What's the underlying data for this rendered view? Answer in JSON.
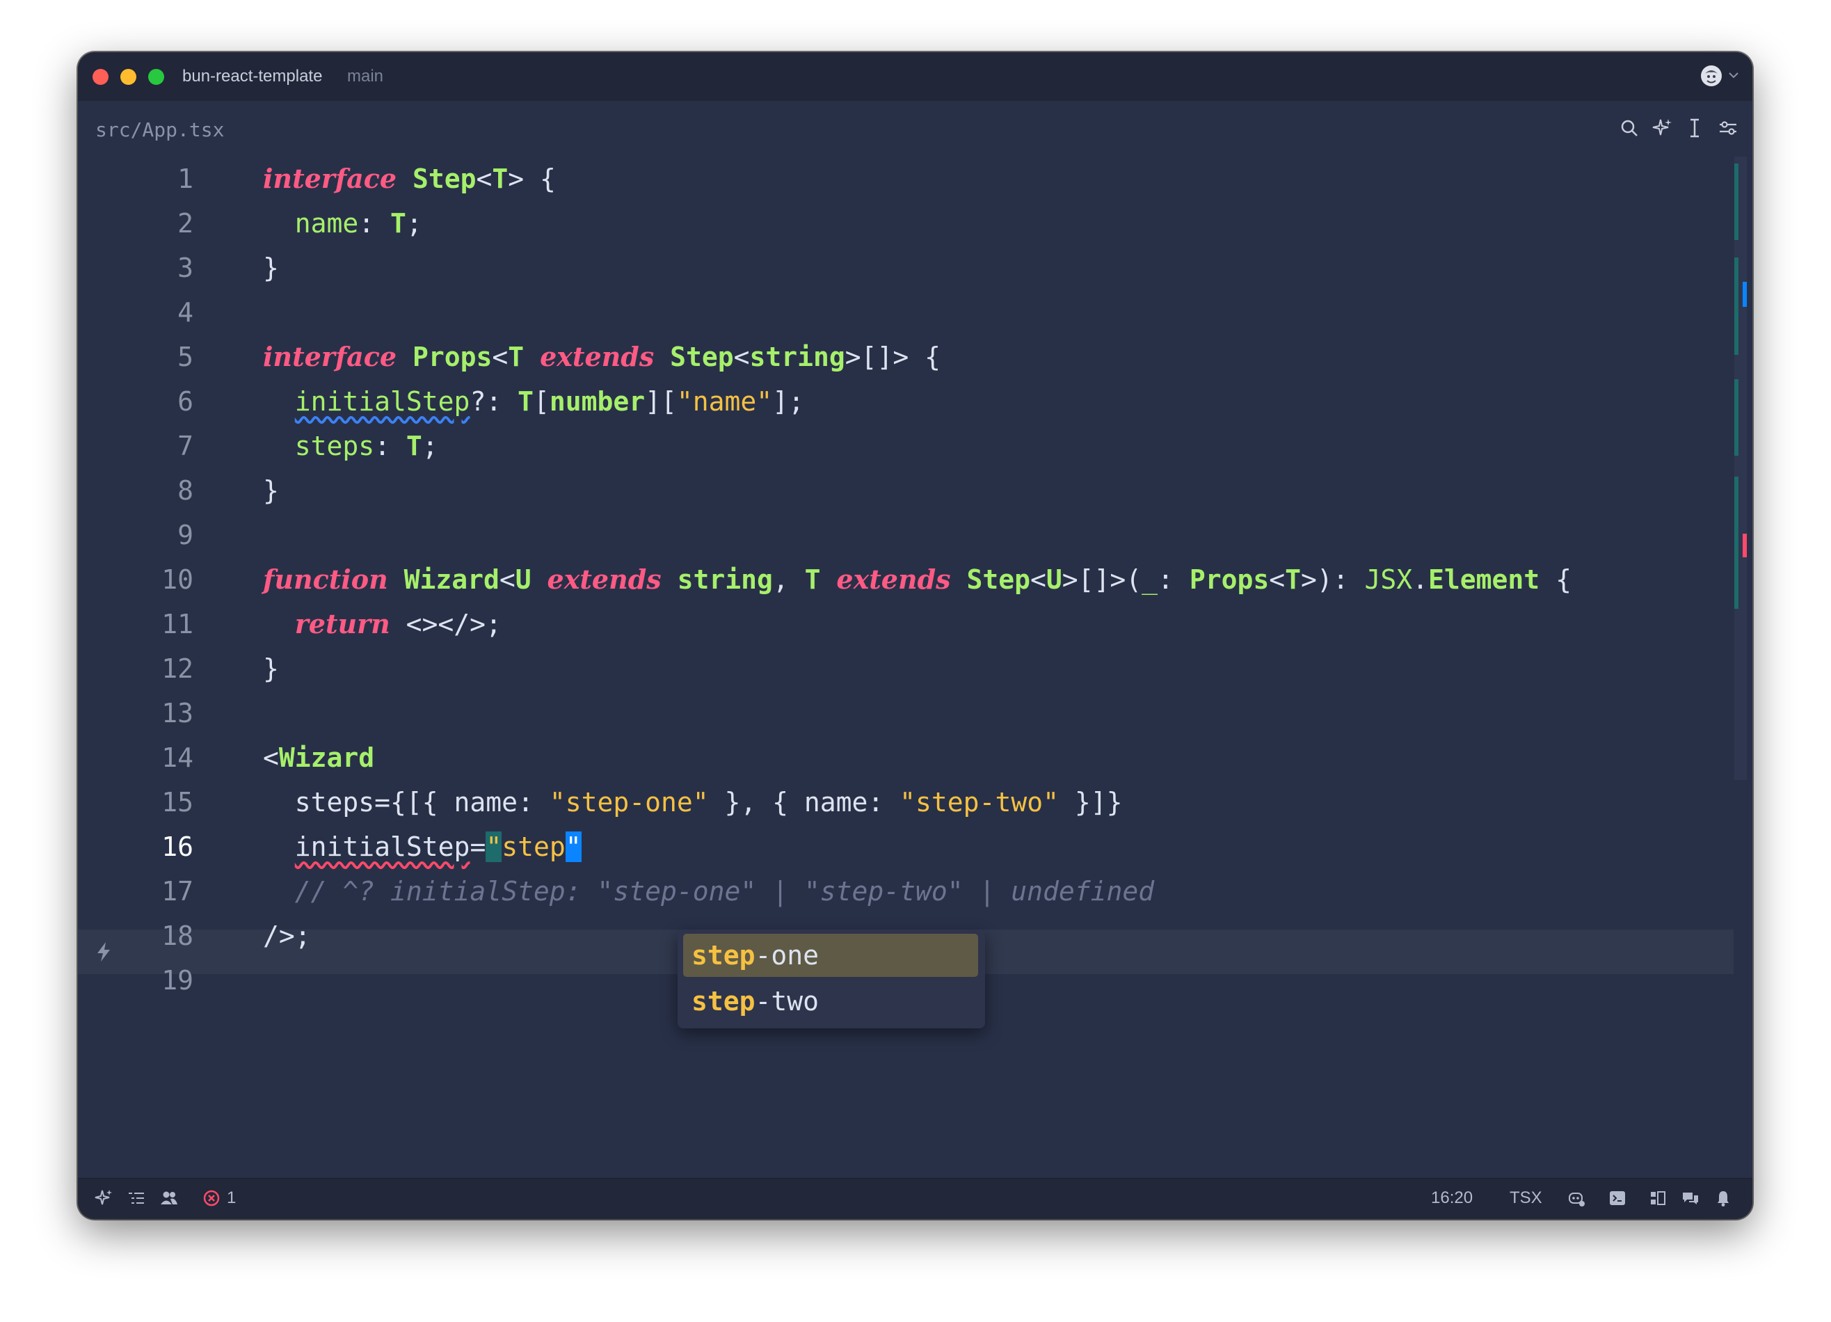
{
  "window": {
    "project": "bun-react-template",
    "branch": "main"
  },
  "tab": {
    "path": "src/App.tsx"
  },
  "toolbar_icons": [
    "search-icon",
    "sparkle-icon",
    "text-cursor-icon",
    "sliders-icon"
  ],
  "editor": {
    "current_line": "16",
    "line_numbers": [
      "1",
      "2",
      "3",
      "4",
      "5",
      "6",
      "7",
      "8",
      "9",
      "10",
      "11",
      "12",
      "13",
      "14",
      "15",
      "16",
      "17",
      "18",
      "19"
    ],
    "lines": [
      [
        [
          "kw",
          "interface"
        ],
        [
          "pn",
          " "
        ],
        [
          "ty",
          "Step"
        ],
        [
          "pn",
          "<"
        ],
        [
          "ty",
          "T"
        ],
        [
          "pn",
          "> {"
        ]
      ],
      [
        [
          "pn",
          "  "
        ],
        [
          "id",
          "name"
        ],
        [
          "pn",
          ": "
        ],
        [
          "ty",
          "T"
        ],
        [
          "pn",
          ";"
        ]
      ],
      [
        [
          "pn",
          "}"
        ]
      ],
      [],
      [
        [
          "kw",
          "interface"
        ],
        [
          "pn",
          " "
        ],
        [
          "ty",
          "Props"
        ],
        [
          "pn",
          "<"
        ],
        [
          "ty",
          "T"
        ],
        [
          "pn",
          " "
        ],
        [
          "kw",
          "extends"
        ],
        [
          "pn",
          " "
        ],
        [
          "ty",
          "Step"
        ],
        [
          "pn",
          "<"
        ],
        [
          "ty",
          "string"
        ],
        [
          "pn",
          ">[]> {"
        ]
      ],
      [
        [
          "pn",
          "  "
        ],
        [
          "id sq-blue",
          "initialStep"
        ],
        [
          "pn",
          "?: "
        ],
        [
          "ty",
          "T"
        ],
        [
          "pn",
          "["
        ],
        [
          "ty",
          "number"
        ],
        [
          "pn",
          "]["
        ],
        [
          "str",
          "\"name\""
        ],
        [
          "pn",
          "];"
        ]
      ],
      [
        [
          "pn",
          "  "
        ],
        [
          "id",
          "steps"
        ],
        [
          "pn",
          ": "
        ],
        [
          "ty",
          "T"
        ],
        [
          "pn",
          ";"
        ]
      ],
      [
        [
          "pn",
          "}"
        ]
      ],
      [],
      [
        [
          "kw",
          "function"
        ],
        [
          "pn",
          " "
        ],
        [
          "ty",
          "Wizard"
        ],
        [
          "pn",
          "<"
        ],
        [
          "ty",
          "U"
        ],
        [
          "pn",
          " "
        ],
        [
          "kw",
          "extends"
        ],
        [
          "pn",
          " "
        ],
        [
          "ty",
          "string"
        ],
        [
          "pn",
          ", "
        ],
        [
          "ty",
          "T"
        ],
        [
          "pn",
          " "
        ],
        [
          "kw",
          "extends"
        ],
        [
          "pn",
          " "
        ],
        [
          "ty",
          "Step"
        ],
        [
          "pn",
          "<"
        ],
        [
          "ty",
          "U"
        ],
        [
          "pn",
          ">[]>("
        ],
        [
          "id",
          "_"
        ],
        [
          "pn",
          ": "
        ],
        [
          "ty",
          "Props"
        ],
        [
          "pn",
          "<"
        ],
        [
          "ty",
          "T"
        ],
        [
          "pn",
          ">): "
        ],
        [
          "id",
          "JSX"
        ],
        [
          "pn",
          "."
        ],
        [
          "ty",
          "Element"
        ],
        [
          "pn",
          " {"
        ]
      ],
      [
        [
          "pn",
          "  "
        ],
        [
          "kw",
          "return"
        ],
        [
          "pn",
          " <></>;"
        ]
      ],
      [
        [
          "pn",
          "}"
        ]
      ],
      [],
      [
        [
          "pn",
          "<"
        ],
        [
          "ty",
          "Wizard"
        ]
      ],
      [
        [
          "pn",
          "  steps={[{ "
        ],
        [
          "pn",
          "name"
        ],
        [
          "pn",
          ": "
        ],
        [
          "str",
          "\"step-one\""
        ],
        [
          "pn",
          " }, { "
        ],
        [
          "pn",
          "name"
        ],
        [
          "pn",
          ": "
        ],
        [
          "str",
          "\"step-two\""
        ],
        [
          "pn",
          " }]}"
        ]
      ],
      [
        [
          "pn",
          "  "
        ],
        [
          "pn sq-red",
          "initialStep"
        ],
        [
          "pn",
          "="
        ],
        [
          "sel-open",
          "\""
        ],
        [
          "str",
          "step"
        ],
        [
          "caret",
          "\""
        ]
      ],
      [
        [
          "cmt",
          "  // ^? initialStep: \"step-one\" | \"step-two\" | undefined"
        ]
      ],
      [
        [
          "pn",
          "/>;"
        ]
      ],
      []
    ]
  },
  "autocomplete": {
    "items": [
      {
        "match": "step",
        "rest": "-one",
        "selected": true
      },
      {
        "match": "step",
        "rest": "-two",
        "selected": false
      }
    ]
  },
  "statusbar": {
    "error_count": "1",
    "cursor_position": "16:20",
    "language": "TSX"
  },
  "colors": {
    "background": "#283048",
    "keyword": "#ff5a84",
    "type": "#a6f06a",
    "string": "#f6c142",
    "comment": "#6c7590",
    "error": "#ff4a6a",
    "cursor": "#0b84ff"
  }
}
